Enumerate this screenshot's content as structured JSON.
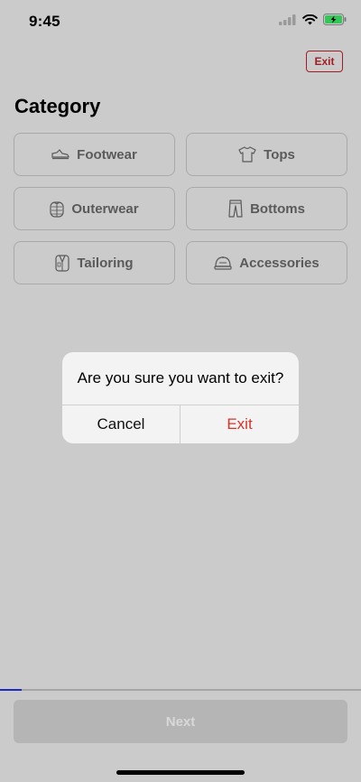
{
  "status_bar": {
    "time": "9:45",
    "battery_charging": true
  },
  "header": {
    "exit_label": "Exit"
  },
  "page_title": "Category",
  "categories": [
    {
      "label": "Footwear",
      "icon": "sneaker-icon"
    },
    {
      "label": "Tops",
      "icon": "tshirt-icon"
    },
    {
      "label": "Outerwear",
      "icon": "jacket-icon"
    },
    {
      "label": "Bottoms",
      "icon": "pants-icon"
    },
    {
      "label": "Tailoring",
      "icon": "suit-icon"
    },
    {
      "label": "Accessories",
      "icon": "cap-icon"
    }
  ],
  "dialog": {
    "message": "Are you sure you want to exit?",
    "cancel_label": "Cancel",
    "exit_label": "Exit"
  },
  "progress": {
    "fraction": 0.06
  },
  "footer": {
    "next_label": "Next"
  },
  "colors": {
    "accent_red": "#a11d24",
    "exit_red": "#d8332a",
    "progress_blue": "#1f2ac0"
  }
}
